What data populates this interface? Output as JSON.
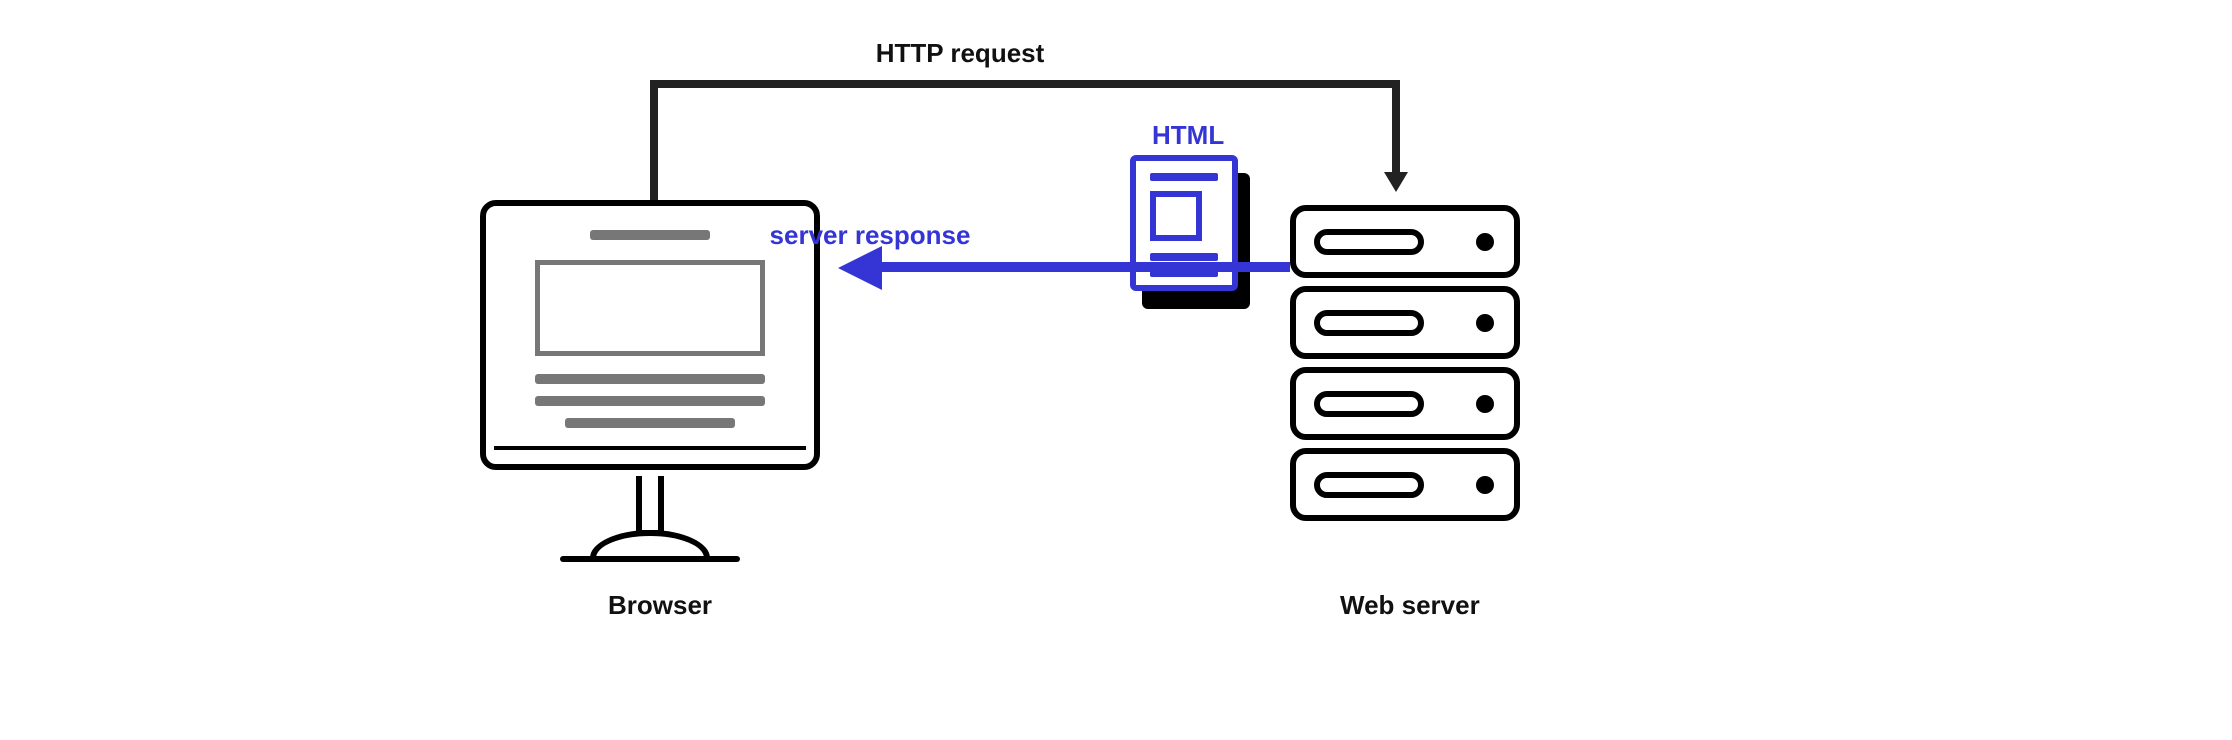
{
  "labels": {
    "request": "HTTP request",
    "response": "server response",
    "html": "HTML",
    "browser": "Browser",
    "server": "Web server"
  },
  "components": {
    "client": "Browser",
    "server": "Web server",
    "payload": "HTML"
  },
  "flows": [
    {
      "from": "Browser",
      "to": "Web server",
      "label": "HTTP request",
      "color": "#222222"
    },
    {
      "from": "Web server",
      "to": "Browser",
      "label": "server response",
      "payload": "HTML",
      "color": "#3535d6"
    }
  ],
  "colors": {
    "accent_blue": "#3535d6",
    "line_black": "#222222",
    "gray": "#777777"
  }
}
